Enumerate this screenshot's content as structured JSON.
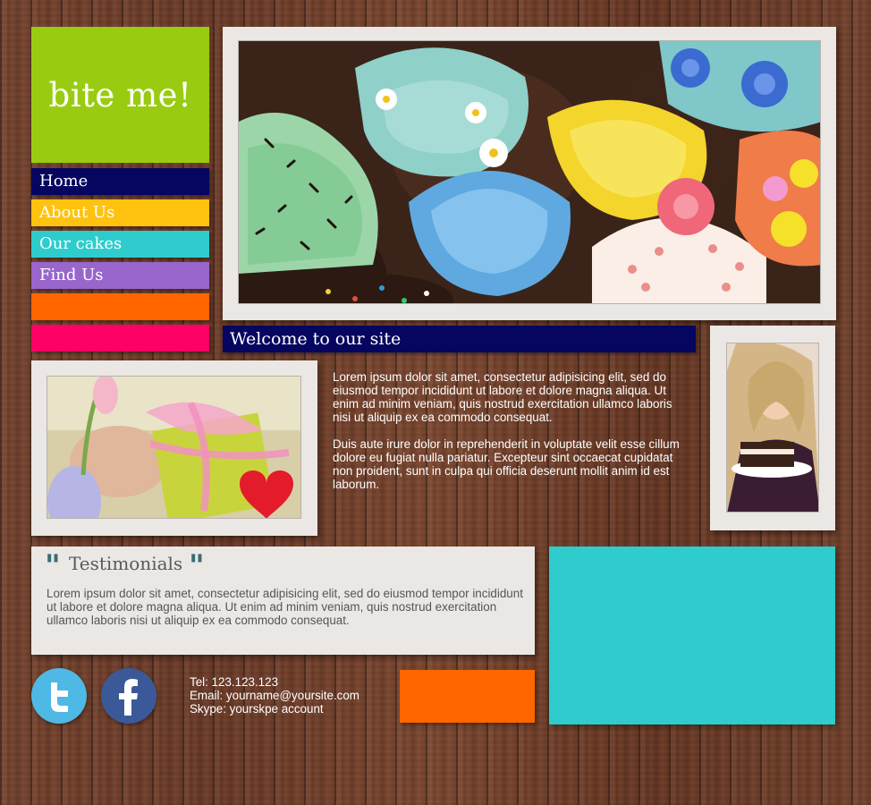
{
  "brand": {
    "logo_text": "bite me!",
    "logo_color": "#99cc11"
  },
  "nav": {
    "items": [
      {
        "label": "Home",
        "color": "#060660"
      },
      {
        "label": "About Us",
        "color": "#ffc20e"
      },
      {
        "label": "Our cakes",
        "color": "#2ecccc"
      },
      {
        "label": "Find Us",
        "color": "#9966cc"
      },
      {
        "label": "",
        "color": "#ff6600"
      },
      {
        "label": "",
        "color": "#ff0066"
      }
    ]
  },
  "welcome": {
    "heading": "Welcome to our site",
    "paragraph_1": "Lorem ipsum dolor sit amet, consectetur adipisicing elit, sed do eiusmod tempor incididunt ut labore et dolore magna aliqua. Ut enim ad minim veniam, quis nostrud exercitation ullamco laboris nisi ut aliquip ex ea commodo consequat.",
    "paragraph_2": "Duis aute irure dolor in reprehenderit in voluptate velit esse cillum dolore eu fugiat nulla pariatur. Excepteur sint occaecat cupidatat non proident, sunt in culpa qui officia deserunt mollit anim id est laborum."
  },
  "testimonials": {
    "heading": "Testimonials",
    "quote_open": "\"",
    "quote_close": "\"",
    "text": "Lorem ipsum dolor sit amet, consectetur adipisicing elit, sed do eiusmod tempor incididunt ut labore et dolore magna aliqua. Ut enim ad minim veniam, quis nostrud exercitation ullamco laboris nisi ut aliquip ex ea commodo consequat."
  },
  "contact": {
    "tel": "Tel: 123.123.123",
    "email": "Email: yourname@yoursite.com",
    "skype": "Skype: yourskpe account"
  },
  "social": {
    "twitter_icon": "twitter-icon",
    "facebook_icon": "facebook-icon",
    "twitter_color": "#4fb9e5",
    "facebook_color": "#3b5998"
  },
  "accents": {
    "orange": "#ff6600",
    "teal": "#2ecccc"
  }
}
